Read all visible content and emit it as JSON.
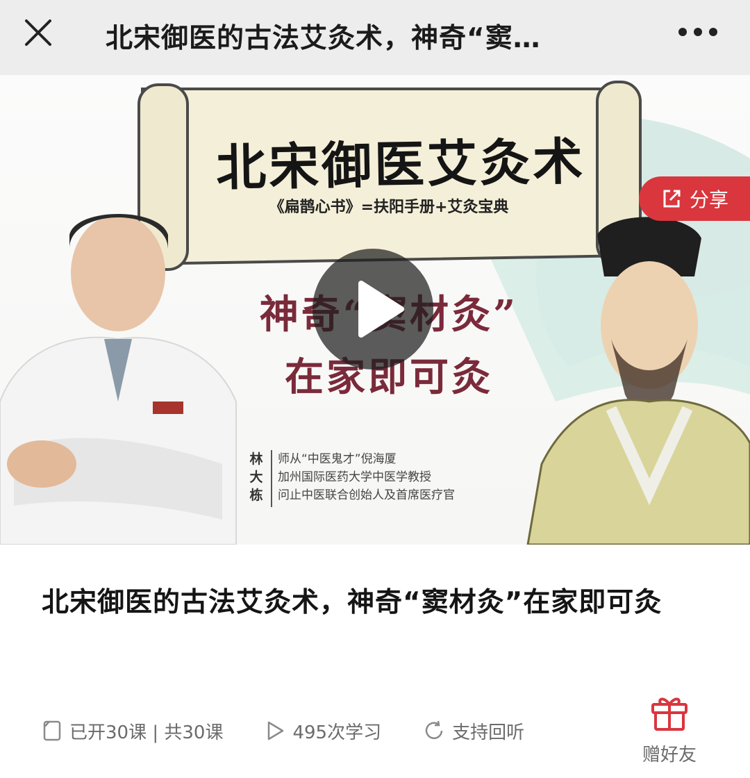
{
  "topbar": {
    "title": "北宋御医的古法艾灸术，神奇“窦…",
    "close_icon": "close-icon",
    "more_icon": "more-icon"
  },
  "cover": {
    "banner_title": "北宋御医艾灸术",
    "banner_subtitle": "《扁鹊心书》=扶阳手册+艾灸宝典",
    "headline_line1": "神奇“窦材灸”",
    "headline_line2": "在家即可灸",
    "doctor_name": "林大栋",
    "doctor_info": [
      "师从“中医鬼才”倪海厦",
      "加州国际医药大学中医学教授",
      "问止中医联合创始人及首席医疗官"
    ],
    "share_label": "分享",
    "play_icon": "play-icon"
  },
  "course": {
    "title": "北宋御医的古法艾灸术，神奇“窦材灸”在家即可灸"
  },
  "stats": {
    "lessons": "已开30课 | 共30课",
    "views": "495次学习",
    "replay": "支持回听"
  },
  "gift": {
    "label": "赠好友"
  },
  "colors": {
    "topbar_bg": "#ededed",
    "share_bg": "#d9363e",
    "headline": "#7a2a3a",
    "stat_text": "#6b6b6b",
    "gift_icon": "#d9363e"
  }
}
